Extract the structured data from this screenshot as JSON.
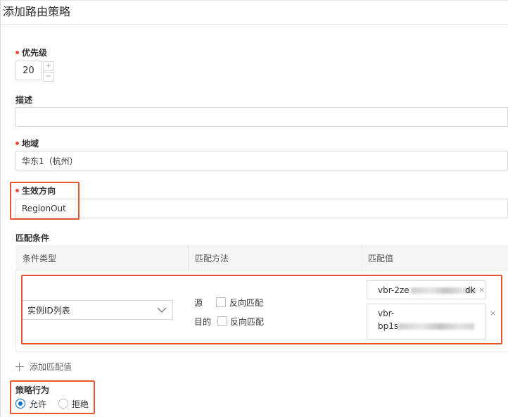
{
  "dialog": {
    "title": "添加路由策略"
  },
  "priority": {
    "label": "优先级",
    "value": "20",
    "increment_symbol": "+",
    "decrement_symbol": "−"
  },
  "description": {
    "label": "描述",
    "value": ""
  },
  "region": {
    "label": "地域",
    "value": "华东1（杭州）"
  },
  "direction": {
    "label": "生效方向",
    "value": "RegionOut"
  },
  "match_conditions": {
    "label": "匹配条件",
    "columns": [
      "条件类型",
      "匹配方法",
      "匹配值"
    ],
    "condition_type": "实例ID列表",
    "methods": [
      {
        "label": "源",
        "checkbox_label": "反向匹配",
        "checked": false
      },
      {
        "label": "目的",
        "checkbox_label": "反向匹配",
        "checked": false
      }
    ],
    "values": [
      {
        "prefix": "vbr-2ze",
        "suffix": "dk"
      },
      {
        "line1": "vbr-",
        "line2_prefix": "bp1s"
      }
    ],
    "close_symbol": "×",
    "add_label": "添加匹配值"
  },
  "action": {
    "label": "策略行为",
    "options": [
      {
        "label": "允许",
        "selected": true
      },
      {
        "label": "拒绝",
        "selected": false
      }
    ]
  },
  "colors": {
    "highlight": "#e8552e",
    "required_dot": "#f0503c",
    "radio_selected": "#0070cc"
  }
}
